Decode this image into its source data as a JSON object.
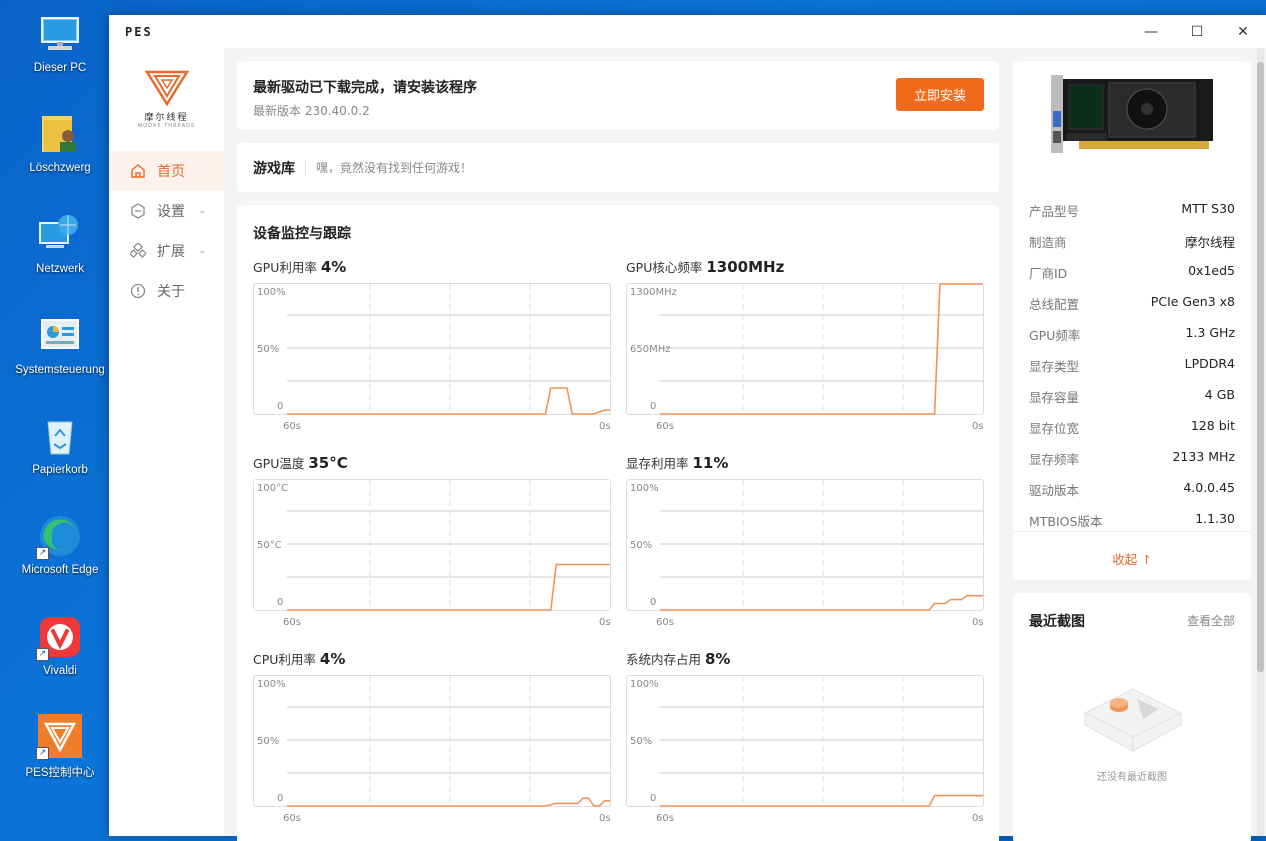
{
  "desktop": {
    "icons": [
      {
        "label": "Dieser PC",
        "icon": "computer-icon"
      },
      {
        "label": "Löschzwerg",
        "icon": "user-folder-icon"
      },
      {
        "label": "Netzwerk",
        "icon": "network-icon"
      },
      {
        "label": "Systemsteuerung",
        "icon": "control-panel-icon"
      },
      {
        "label": "Papierkorb",
        "icon": "recycle-bin-icon"
      },
      {
        "label": "Microsoft Edge",
        "icon": "edge-icon"
      },
      {
        "label": "Vivaldi",
        "icon": "vivaldi-icon"
      },
      {
        "label": "PES控制中心",
        "icon": "pes-icon"
      }
    ]
  },
  "window": {
    "title": "PES",
    "controls": {
      "minimize": "—",
      "maximize": "☐",
      "close": "✕"
    }
  },
  "sidebar": {
    "logo_cn": "摩尔线程",
    "logo_en": "MOORE THREADS",
    "items": [
      {
        "label": "首页",
        "icon": "home-icon",
        "active": true
      },
      {
        "label": "设置",
        "icon": "settings-hexagon-icon",
        "has_children": true
      },
      {
        "label": "扩展",
        "icon": "extension-icon",
        "has_children": true
      },
      {
        "label": "关于",
        "icon": "info-icon"
      }
    ]
  },
  "notice": {
    "title": "最新驱动已下载完成，请安装该程序",
    "version": "最新版本 230.40.0.2",
    "button": "立即安装"
  },
  "gamelib": {
    "title": "游戏库",
    "message": "嘿，竟然没有找到任何游戏！"
  },
  "monitor": {
    "title": "设备监控与跟踪",
    "charts": [
      {
        "label": "GPU利用率",
        "value": "4%",
        "ymax": "100%",
        "ymid": "50%",
        "ymin": "0",
        "xstart": "60s",
        "xend": "0s"
      },
      {
        "label": "GPU核心频率",
        "value": "1300MHz",
        "ymax": "1300MHz",
        "ymid": "650MHz",
        "ymin": "0",
        "xstart": "60s",
        "xend": "0s"
      },
      {
        "label": "GPU温度",
        "value": "35°C",
        "ymax": "100°C",
        "ymid": "50°C",
        "ymin": "0",
        "xstart": "60s",
        "xend": "0s"
      },
      {
        "label": "显存利用率",
        "value": "11%",
        "ymax": "100%",
        "ymid": "50%",
        "ymin": "0",
        "xstart": "60s",
        "xend": "0s"
      },
      {
        "label": "CPU利用率",
        "value": "4%",
        "ymax": "100%",
        "ymid": "50%",
        "ymin": "0",
        "xstart": "60s",
        "xend": "0s"
      },
      {
        "label": "系统内存占用",
        "value": "8%",
        "ymax": "100%",
        "ymid": "50%",
        "ymin": "0",
        "xstart": "60s",
        "xend": "0s"
      }
    ]
  },
  "chart_data": [
    {
      "type": "line",
      "title": "GPU利用率",
      "xlim": [
        60,
        0
      ],
      "ylim": [
        0,
        100
      ],
      "x": [
        60,
        12,
        11,
        10,
        8,
        7,
        3,
        1,
        0
      ],
      "y": [
        0,
        0,
        20,
        20,
        20,
        0,
        0,
        3,
        3
      ]
    },
    {
      "type": "line",
      "title": "GPU核心频率",
      "xlim": [
        60,
        0
      ],
      "ylim": [
        0,
        1300
      ],
      "x": [
        60,
        10,
        9,
        8,
        0
      ],
      "y": [
        0,
        0,
        0,
        1300,
        1300
      ]
    },
    {
      "type": "line",
      "title": "GPU温度",
      "xlim": [
        60,
        0
      ],
      "ylim": [
        0,
        100
      ],
      "x": [
        60,
        11,
        10,
        0
      ],
      "y": [
        0,
        0,
        35,
        35
      ]
    },
    {
      "type": "line",
      "title": "显存利用率",
      "xlim": [
        60,
        0
      ],
      "ylim": [
        0,
        100
      ],
      "x": [
        60,
        10,
        9,
        7,
        6,
        4,
        3,
        1,
        0
      ],
      "y": [
        0,
        0,
        5,
        5,
        8,
        8,
        11,
        11,
        11
      ]
    },
    {
      "type": "line",
      "title": "CPU利用率",
      "xlim": [
        60,
        0
      ],
      "ylim": [
        0,
        100
      ],
      "x": [
        60,
        12,
        10,
        6,
        5,
        4,
        3,
        2,
        1,
        0
      ],
      "y": [
        0,
        0,
        2,
        2,
        6,
        6,
        0,
        0,
        4,
        4
      ]
    },
    {
      "type": "line",
      "title": "系统内存占用",
      "xlim": [
        60,
        0
      ],
      "ylim": [
        0,
        100
      ],
      "x": [
        60,
        10,
        9,
        0
      ],
      "y": [
        0,
        0,
        8,
        8
      ]
    }
  ],
  "specs": [
    {
      "k": "产品型号",
      "v": "MTT S30"
    },
    {
      "k": "制造商",
      "v": "摩尔线程"
    },
    {
      "k": "厂商ID",
      "v": "0x1ed5"
    },
    {
      "k": "总线配置",
      "v": "PCIe Gen3 x8"
    },
    {
      "k": "GPU频率",
      "v": "1.3 GHz"
    },
    {
      "k": "显存类型",
      "v": "LPDDR4"
    },
    {
      "k": "显存容量",
      "v": "4 GB"
    },
    {
      "k": "显存位宽",
      "v": "128 bit"
    },
    {
      "k": "显存频率",
      "v": "2133 MHz"
    },
    {
      "k": "驱动版本",
      "v": "4.0.0.45"
    },
    {
      "k": "MTBIOS版本",
      "v": "1.1.30"
    }
  ],
  "collapse_label": "收起 ↾",
  "screenshots": {
    "title": "最近截图",
    "view_all": "查看全部",
    "empty": "还没有最近截图"
  },
  "colors": {
    "accent": "#f26b1d",
    "line": "#f0955a",
    "desktop": "#0b74d8"
  }
}
